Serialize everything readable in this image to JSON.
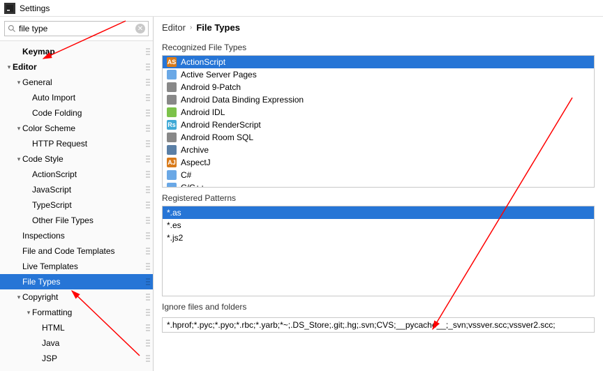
{
  "window": {
    "title": "Settings"
  },
  "search": {
    "value": "file type"
  },
  "sidebar": {
    "items": [
      {
        "indent": 1,
        "chev": "",
        "label": "Keymap",
        "bold": true
      },
      {
        "indent": 0,
        "chev": "▾",
        "label": "Editor",
        "bold": true
      },
      {
        "indent": 1,
        "chev": "▾",
        "label": "General"
      },
      {
        "indent": 2,
        "chev": "",
        "label": "Auto Import"
      },
      {
        "indent": 2,
        "chev": "",
        "label": "Code Folding"
      },
      {
        "indent": 1,
        "chev": "▾",
        "label": "Color Scheme"
      },
      {
        "indent": 2,
        "chev": "",
        "label": "HTTP Request"
      },
      {
        "indent": 1,
        "chev": "▾",
        "label": "Code Style"
      },
      {
        "indent": 2,
        "chev": "",
        "label": "ActionScript"
      },
      {
        "indent": 2,
        "chev": "",
        "label": "JavaScript"
      },
      {
        "indent": 2,
        "chev": "",
        "label": "TypeScript"
      },
      {
        "indent": 2,
        "chev": "",
        "label": "Other File Types"
      },
      {
        "indent": 1,
        "chev": "",
        "label": "Inspections"
      },
      {
        "indent": 1,
        "chev": "",
        "label": "File and Code Templates"
      },
      {
        "indent": 1,
        "chev": "",
        "label": "Live Templates"
      },
      {
        "indent": 1,
        "chev": "",
        "label": "File Types",
        "selected": true
      },
      {
        "indent": 1,
        "chev": "▾",
        "label": "Copyright"
      },
      {
        "indent": 2,
        "chev": "▾",
        "label": "Formatting"
      },
      {
        "indent": 3,
        "chev": "",
        "label": "HTML"
      },
      {
        "indent": 3,
        "chev": "",
        "label": "Java"
      },
      {
        "indent": 3,
        "chev": "",
        "label": "JSP"
      }
    ]
  },
  "breadcrumb": {
    "part1": "Editor",
    "part2": "File Types"
  },
  "sections": {
    "recognized": "Recognized File Types",
    "patterns": "Registered Patterns",
    "ignore": "Ignore files and folders"
  },
  "filetypes": [
    {
      "label": "ActionScript",
      "icon_bg": "#d87a1a",
      "icon_txt": "AS",
      "selected": true
    },
    {
      "label": "Active Server Pages",
      "icon_bg": "#6aa8e6",
      "icon_txt": ""
    },
    {
      "label": "Android 9-Patch",
      "icon_bg": "#888",
      "icon_txt": ""
    },
    {
      "label": "Android Data Binding Expression",
      "icon_bg": "#888",
      "icon_txt": ""
    },
    {
      "label": "Android IDL",
      "icon_bg": "#7cc24a",
      "icon_txt": ""
    },
    {
      "label": "Android RenderScript",
      "icon_bg": "#3fa9d6",
      "icon_txt": "Rs"
    },
    {
      "label": "Android Room SQL",
      "icon_bg": "#888",
      "icon_txt": ""
    },
    {
      "label": "Archive",
      "icon_bg": "#5a7fa6",
      "icon_txt": ""
    },
    {
      "label": "AspectJ",
      "icon_bg": "#d87a1a",
      "icon_txt": "AJ"
    },
    {
      "label": "C#",
      "icon_bg": "#6aa8e6",
      "icon_txt": ""
    },
    {
      "label": "C/C++",
      "icon_bg": "#6aa8e6",
      "icon_txt": ""
    }
  ],
  "patterns": [
    {
      "label": "*.as",
      "selected": true
    },
    {
      "label": "*.es"
    },
    {
      "label": "*.js2"
    }
  ],
  "ignore_value": "*.hprof;*.pyc;*.pyo;*.rbc;*.yarb;*~;.DS_Store;.git;.hg;.svn;CVS;__pycache__;_svn;vssver.scc;vssver2.scc;"
}
